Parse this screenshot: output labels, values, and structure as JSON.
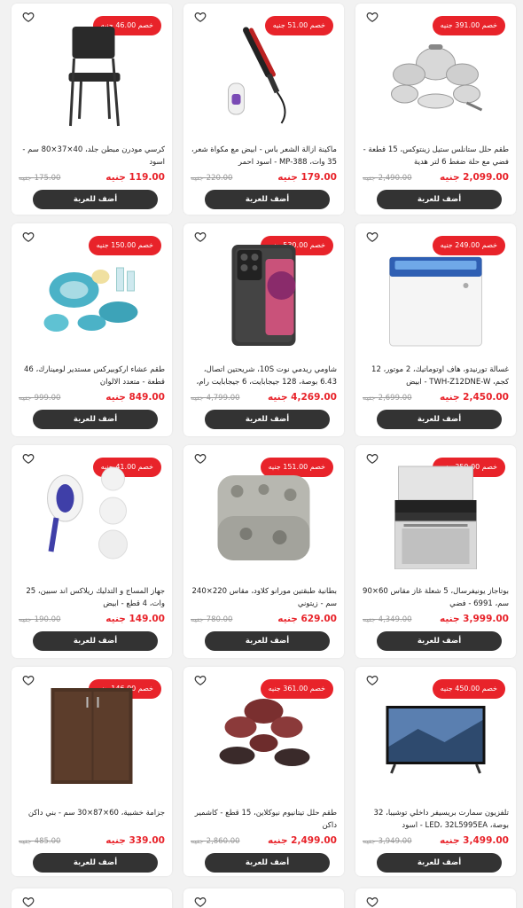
{
  "colors": {
    "accent": "#e8232a",
    "button": "#333333",
    "old_price": "#999999"
  },
  "button_label": "أضف للعربة",
  "products": [
    {
      "title": "طقم حلل ستانلس ستيل زينتوكس، 15 قطعة - فضي مع حلة ضغط 6 لتر هدية",
      "badge": "خصم 391.00 جنيه",
      "price": "2,099.00 جنيه",
      "old_price": "2,490.00 جنيه",
      "icon": "cookware-set-image"
    },
    {
      "title": "ماكينة ازالة الشعر باس - ابيض مع مكواة شعر، 35 وات، MP-388 - اسود احمر",
      "badge": "خصم 51.00 جنيه",
      "price": "179.00 جنيه",
      "old_price": "220.00 جنيه",
      "icon": "hair-straightener-image"
    },
    {
      "title": "كرسي مودرن مبطن جلد، 40×37×80 سم - اسود",
      "badge": "خصم 46.00 جنيه",
      "price": "119.00 جنيه",
      "old_price": "175.00 جنيه",
      "icon": "chair-image"
    },
    {
      "title": "غسالة تورنيدو، هاف اوتوماتيك، 2 موتور، 12 كجم، TWH-Z12DNE-W - ابيض",
      "badge": "خصم 249.00 جنيه",
      "price": "2,450.00 جنيه",
      "old_price": "2,699.00 جنيه",
      "icon": "washing-machine-image"
    },
    {
      "title": "شاومي ريدمي نوت 10S، شريحتين اتصال، 6.43 بوصة، 128 جيجابايت، 6 جيجابايت رام، شبكة الجي...",
      "badge": "خصم 530.00 جنيه",
      "price": "4,269.00 جنيه",
      "old_price": "4,799.00 جنيه",
      "icon": "smartphone-image"
    },
    {
      "title": "طقم عشاء اركوبيركس مستدير لومينارك، 46 قطعة - متعدد الالوان",
      "badge": "خصم 150.00 جنيه",
      "price": "849.00 جنيه",
      "old_price": "999.00 جنيه",
      "icon": "dinner-set-image"
    },
    {
      "title": "بوتاجاز يونيفرسال، 5 شعلة غاز مقاس 60×90 سم، 6991 - فضي",
      "badge": "خصم 350.00 جنيه",
      "price": "3,999.00 جنيه",
      "old_price": "4,349.00 جنيه",
      "icon": "gas-cooker-image"
    },
    {
      "title": "بطانية طبقتين مورانو كلاود، مقاس 220×240 سم - زيتوني",
      "badge": "خصم 151.00 جنيه",
      "price": "629.00 جنيه",
      "old_price": "780.00 جنيه",
      "icon": "blanket-image"
    },
    {
      "title": "جهاز المساج و التدليك ريلاكس اند سبين، 25 وات، 4 قطع - ابيض",
      "badge": "خصم 41.00 جنيه",
      "price": "149.00 جنيه",
      "old_price": "190.00 جنيه",
      "icon": "massager-image"
    },
    {
      "title": "تلفزيون سمارت بريسيفر داخلي توشيبا، 32 بوصة، LED، 32L5995EA - اسود",
      "badge": "خصم 450.00 جنيه",
      "price": "3,499.00 جنيه",
      "old_price": "3,949.00 جنيه",
      "icon": "tv-image"
    },
    {
      "title": "طقم حلل تيتانيوم نيوكلاين، 15 قطع - كاشمير داكن",
      "badge": "خصم 361.00 جنيه",
      "price": "2,499.00 جنيه",
      "old_price": "2,860.00 جنيه",
      "icon": "granite-cookware-image"
    },
    {
      "title": "جزامة خشبية، 60×87×30 سم - بني داكن",
      "badge": "خصم 146.00 جنيه",
      "price": "339.00 جنيه",
      "old_price": "485.00 جنيه",
      "icon": "shoe-cabinet-image"
    }
  ]
}
